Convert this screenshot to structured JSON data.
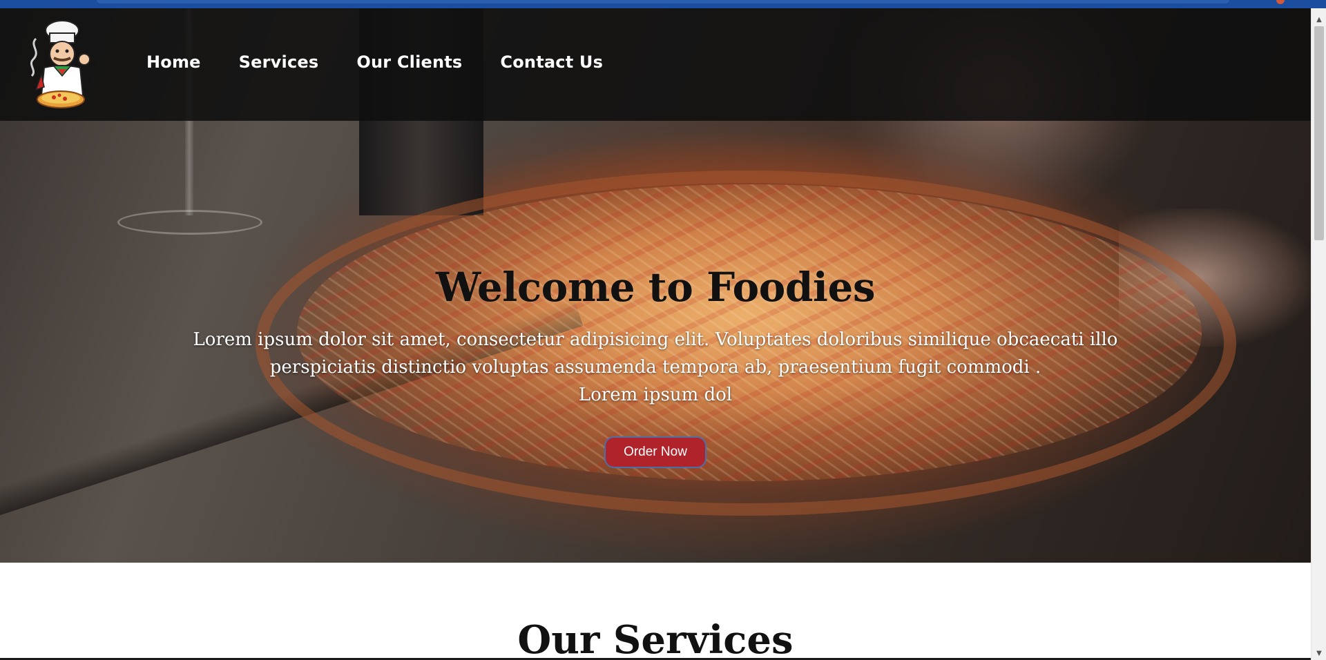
{
  "header": {
    "logo_icon": "chef-pizza-logo-icon",
    "nav": [
      {
        "label": "Home"
      },
      {
        "label": "Services"
      },
      {
        "label": "Our Clients"
      },
      {
        "label": "Contact Us"
      }
    ]
  },
  "hero": {
    "title": "Welcome to Foodies",
    "text_line1": "Lorem ipsum dolor sit amet, consectetur adipisicing elit. Voluptates doloribus similique obcaecati illo",
    "text_line2": "perspiciatis distinctio voluptas assumenda tempora ab, praesentium fugit commodi .",
    "text_line3": "Lorem ipsum dol",
    "button_label": "Order Now",
    "button_color": "#b0232a"
  },
  "services": {
    "title": "Our Services"
  },
  "scrollbar": {
    "up_icon": "scroll-up-arrow-icon",
    "down_icon": "scroll-down-arrow-icon"
  }
}
